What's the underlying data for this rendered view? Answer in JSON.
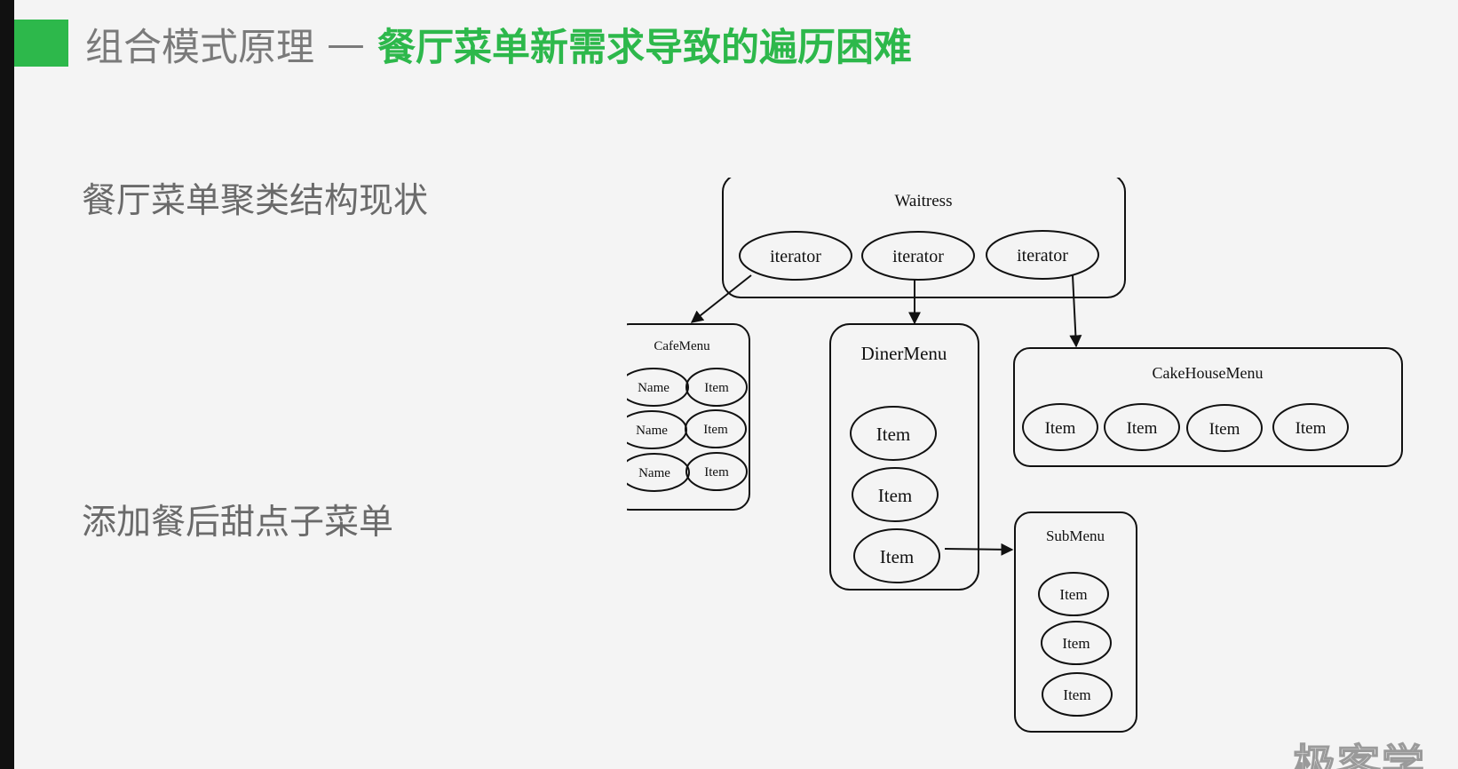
{
  "title": {
    "main": "组合模式原理",
    "separator": "—",
    "accent": "餐厅菜单新需求导致的遍历困难"
  },
  "bullets": {
    "first": "餐厅菜单聚类结构现状",
    "second": "添加餐后甜点子菜单"
  },
  "diagram": {
    "waitress": {
      "label": "Waitress",
      "iterators": [
        "iterator",
        "iterator",
        "iterator"
      ]
    },
    "cafe_menu": {
      "label": "CafeMenu",
      "rows": [
        [
          "Name",
          "Item"
        ],
        [
          "Name",
          "Item"
        ],
        [
          "Name",
          "Item"
        ]
      ]
    },
    "diner_menu": {
      "label": "DinerMenu",
      "items": [
        "Item",
        "Item",
        "Item"
      ]
    },
    "cake_house_menu": {
      "label": "CakeHouseMenu",
      "items": [
        "Item",
        "Item",
        "Item",
        "Item"
      ]
    },
    "sub_menu": {
      "label": "SubMenu",
      "items": [
        "Item",
        "Item",
        "Item"
      ]
    }
  },
  "watermark": "极客学",
  "colors": {
    "accent": "#2db84b",
    "title_gray": "#7a7a7a",
    "body_gray": "#6a6a6a",
    "stroke": "#111111"
  }
}
